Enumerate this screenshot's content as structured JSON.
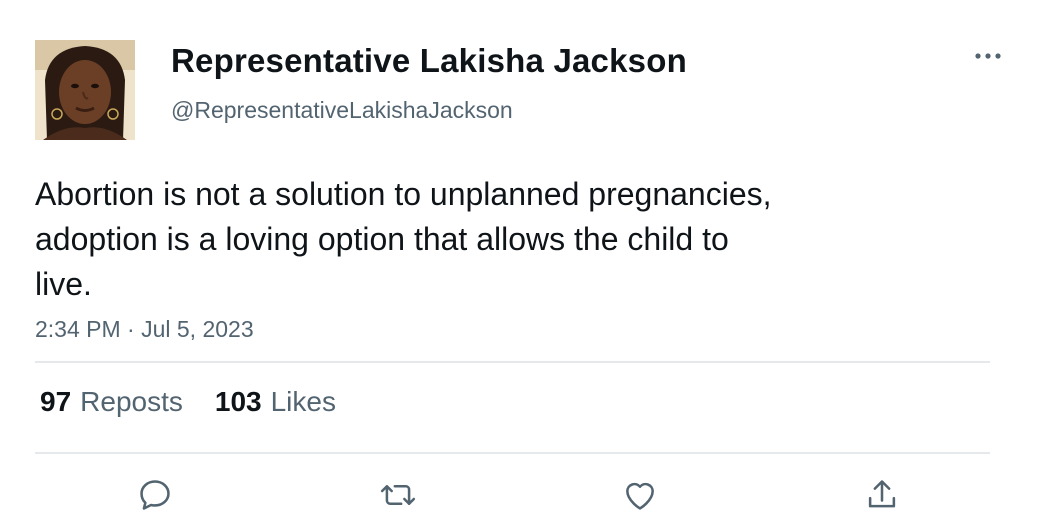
{
  "author": {
    "name": "Representative Lakisha Jackson",
    "handle": "@RepresentativeLakishaJackson",
    "avatar_icon": "profile-photo"
  },
  "tweet": {
    "text": "Abortion is not a solution to unplanned pregnancies,\nadoption is a loving option that allows the child to\nlive.",
    "timestamp": "2:34 PM · Jul 5, 2023"
  },
  "stats": {
    "reposts_count": "97",
    "reposts_label": "Reposts",
    "likes_count": "103",
    "likes_label": "Likes"
  },
  "actions": [
    {
      "icon": "reply-icon"
    },
    {
      "icon": "repost-icon"
    },
    {
      "icon": "like-icon"
    },
    {
      "icon": "share-icon"
    }
  ],
  "colors": {
    "text_primary": "#0f1419",
    "text_secondary": "#536471",
    "divider": "#e6e9ec"
  }
}
